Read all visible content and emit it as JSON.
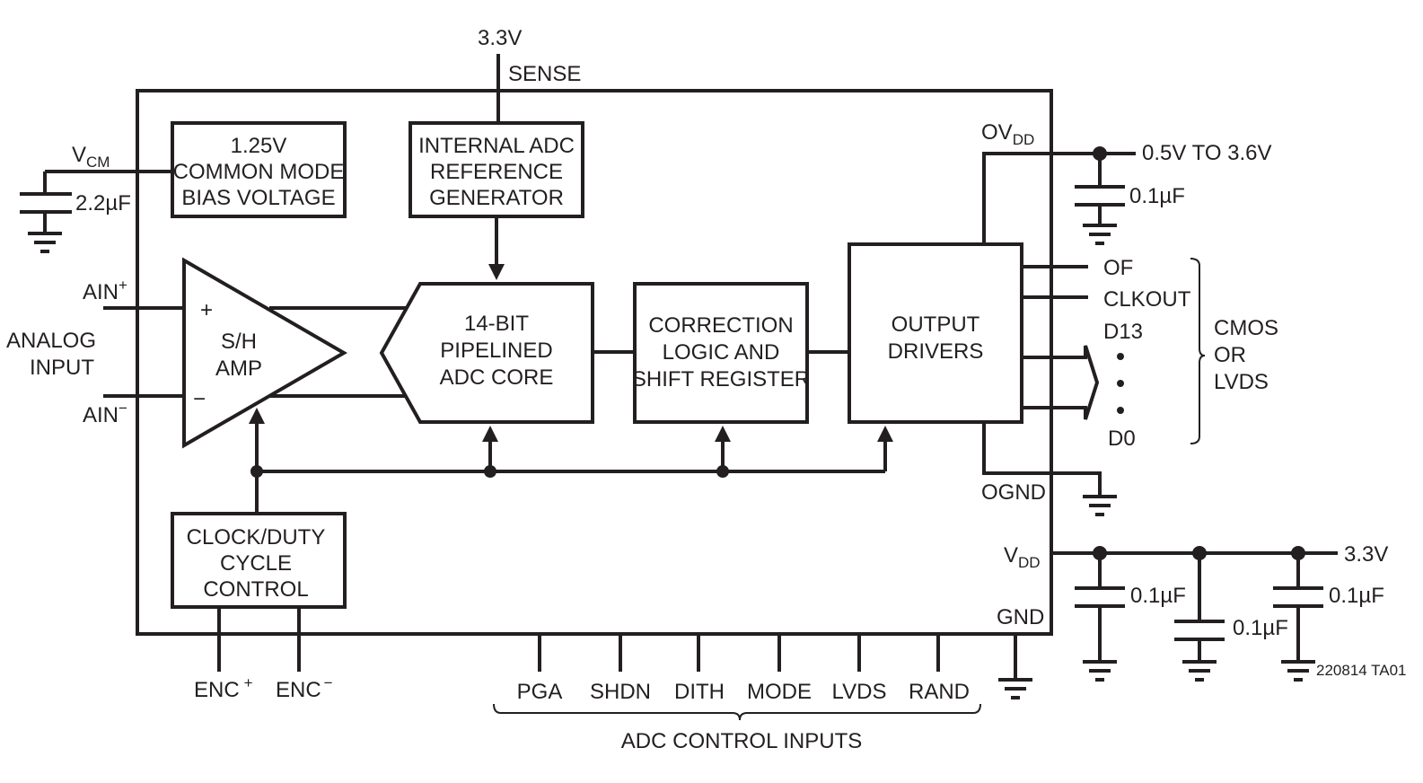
{
  "colors": {
    "ink": "#231f20",
    "background": "#ffffff"
  },
  "top_supply": {
    "voltage": "3.3V",
    "pin": "SENSE"
  },
  "vcm": {
    "label": "V",
    "sub": "CM",
    "cap": "2.2µF"
  },
  "blocks": {
    "bias": [
      "1.25V",
      "COMMON MODE",
      "BIAS VOLTAGE"
    ],
    "reference": [
      "INTERNAL ADC",
      "REFERENCE",
      "GENERATOR"
    ],
    "sh_amp": [
      "S/H",
      "AMP"
    ],
    "adc_core": [
      "14-BIT",
      "PIPELINED",
      "ADC CORE"
    ],
    "correction": [
      "CORRECTION",
      "LOGIC AND",
      "SHIFT REGISTER"
    ],
    "output_drivers": [
      "OUTPUT",
      "DRIVERS"
    ],
    "clock": [
      "CLOCK/DUTY",
      "CYCLE",
      "CONTROL"
    ]
  },
  "analog_input": {
    "label": [
      "ANALOG",
      "INPUT"
    ],
    "ain_plus": "AIN",
    "ain_plus_sup": "+",
    "ain_minus": "AIN",
    "ain_minus_sup": "−",
    "plus_sign": "+",
    "minus_sign": "−"
  },
  "ovdd": {
    "label": "OV",
    "sub": "DD",
    "range": "0.5V TO 3.6V",
    "cap": "0.1µF"
  },
  "outputs": {
    "of": "OF",
    "clkout": "CLKOUT",
    "d13": "D13",
    "d0": "D0",
    "group": [
      "CMOS",
      "OR",
      "LVDS"
    ]
  },
  "ognd": "OGND",
  "vdd": {
    "label": "V",
    "sub": "DD",
    "voltage": "3.3V",
    "caps": [
      "0.1µF",
      "0.1µF",
      "0.1µF"
    ]
  },
  "gnd": "GND",
  "encode": {
    "plus": "ENC",
    "plus_sup": "+",
    "minus": "ENC",
    "minus_sup": "−"
  },
  "control_inputs": {
    "pins": [
      "PGA",
      "SHDN",
      "DITH",
      "MODE",
      "LVDS",
      "RAND"
    ],
    "group": "ADC CONTROL INPUTS"
  },
  "figure_id": "220814 TA01"
}
